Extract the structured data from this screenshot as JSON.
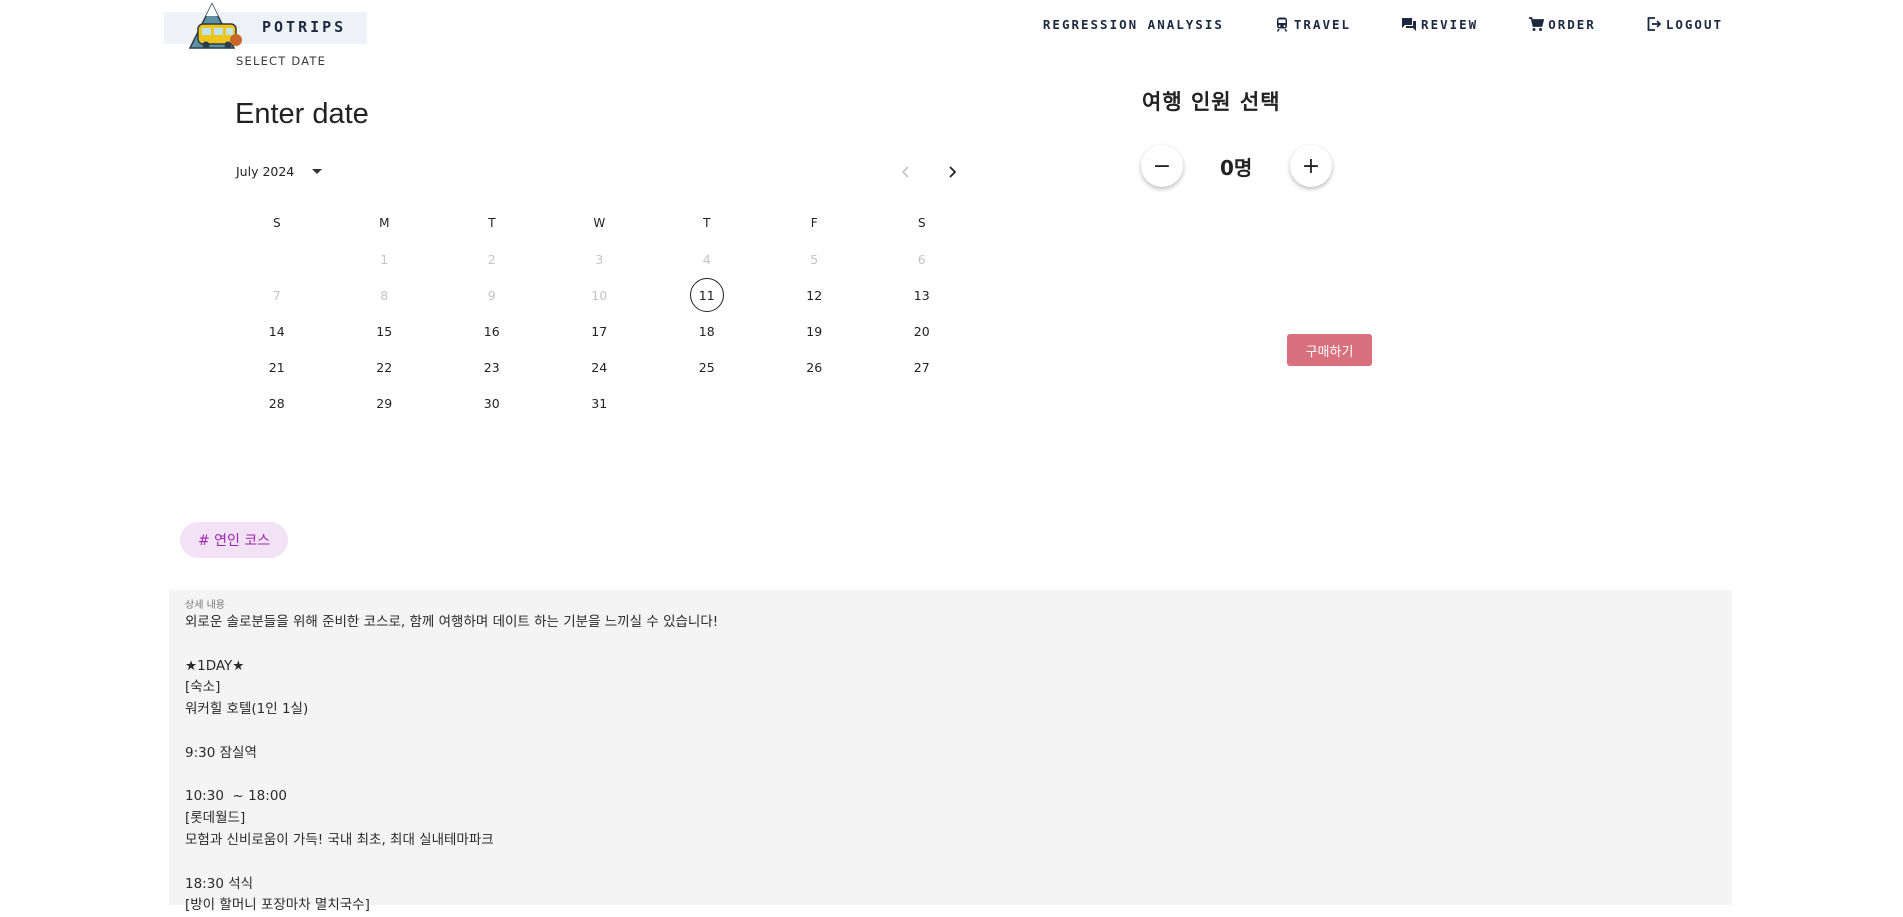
{
  "header": {
    "logo_text": "POTRIPS",
    "nav": [
      {
        "label": "REGRESSION ANALYSIS",
        "icon": ""
      },
      {
        "label": "TRAVEL",
        "icon": "train-icon"
      },
      {
        "label": "REVIEW",
        "icon": "chat-icon"
      },
      {
        "label": "ORDER",
        "icon": "cart-icon"
      },
      {
        "label": "LOGOUT",
        "icon": "logout-icon"
      }
    ]
  },
  "datepicker": {
    "label": "SELECT DATE",
    "heading": "Enter date",
    "month": "July 2024",
    "weekdays": [
      "S",
      "M",
      "T",
      "W",
      "T",
      "F",
      "S"
    ],
    "weeks": [
      [
        "",
        "1",
        "2",
        "3",
        "4",
        "5",
        "6"
      ],
      [
        "7",
        "8",
        "9",
        "10",
        "11",
        "12",
        "13"
      ],
      [
        "14",
        "15",
        "16",
        "17",
        "18",
        "19",
        "20"
      ],
      [
        "21",
        "22",
        "23",
        "24",
        "25",
        "26",
        "27"
      ],
      [
        "28",
        "29",
        "30",
        "31",
        "",
        "",
        ""
      ]
    ],
    "today": "11",
    "disabled_days": [
      "1",
      "2",
      "3",
      "4",
      "5",
      "6",
      "7",
      "8",
      "9",
      "10"
    ]
  },
  "people": {
    "title": "여행 인원 선택",
    "minus_label": "−",
    "plus_label": "+",
    "count": "0명"
  },
  "buy_label": "구매하기",
  "tag": "# 연인 코스",
  "details": {
    "label": "상세 내용",
    "body": "외로운 솔로분들을 위해 준비한 코스로, 함께 여행하며 데이트 하는 기분을 느끼실 수 있습니다!\n\n★1DAY★\n[숙소]\n워커힐 호텔(1인 1실)\n\n9:30 잠실역\n\n10:30  ~ 18:00\n[롯데월드]\n모험과 신비로움이 가득! 국내 최초, 최대 실내테마파크\n\n18:30 석식\n[방이 할머니 포장마차 멸치국수]"
  }
}
